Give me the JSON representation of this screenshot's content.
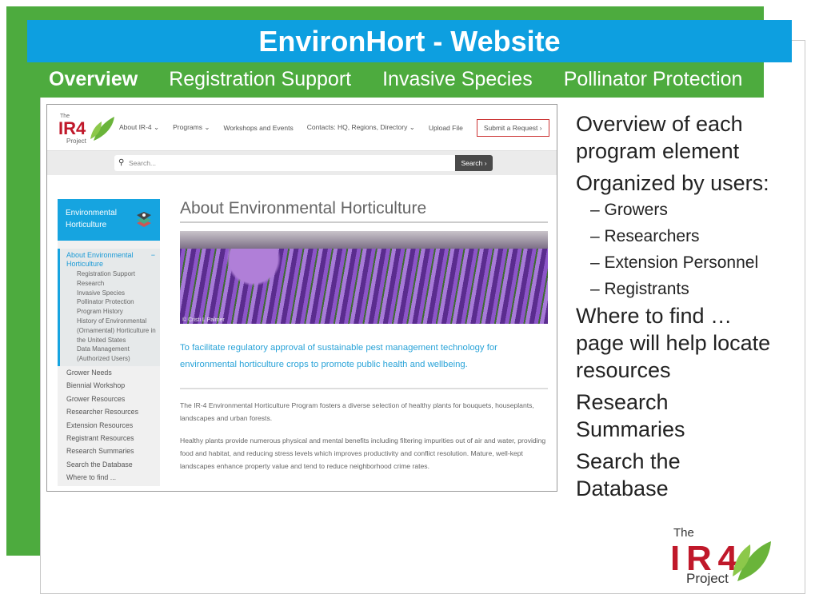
{
  "slide": {
    "title": "EnvironHort - Website",
    "tabs": [
      {
        "label": "Overview",
        "active": true
      },
      {
        "label": "Registration Support"
      },
      {
        "label": "Invasive Species"
      },
      {
        "label": "Pollinator Protection"
      }
    ],
    "bullets": {
      "b1": "Overview of each program element",
      "b2": "Organized by users:",
      "subs": [
        "– Growers",
        "– Researchers",
        "– Extension Personnel",
        "– Registrants"
      ],
      "b3": "Where to find … page will help locate resources",
      "b4": "Research Summaries",
      "b5": "Search the Database"
    },
    "logo": {
      "the": "The",
      "name": "IR-4",
      "project": "Project"
    }
  },
  "site": {
    "logo": {
      "the": "The",
      "name": "IR-4",
      "project": "Project"
    },
    "nav": [
      "About IR-4 ⌄",
      "Programs ⌄",
      "Workshops and Events",
      "Contacts: HQ, Regions, Directory ⌄",
      "Upload File"
    ],
    "submit": "Submit a Request  ›",
    "search_placeholder": "Search...",
    "search_button": "Search ›",
    "sidebar": {
      "title1": "Environmental",
      "title2": "Horticulture",
      "lead": "About Environmental Horticulture",
      "subitems": [
        "Registration Support Research",
        "Invasive Species",
        "Pollinator Protection",
        "Program History",
        "History of Environmental (Ornamental) Horticulture in the United States",
        "Data Management (Authorized Users)"
      ],
      "links": [
        "Grower Needs",
        "Biennial Workshop",
        "Grower Resources",
        "Researcher Resources",
        "Extension Resources",
        "Registrant Resources",
        "Research Summaries",
        "Search the Database",
        "Where to find ..."
      ]
    },
    "heading": "About Environmental Horticulture",
    "photo_credit": "© Cristi L Palmer",
    "mission": "To facilitate regulatory approval of sustainable pest management technology for environmental horticulture crops to promote public health and wellbeing.",
    "para1": "The IR-4 Environmental Horticulture Program fosters a diverse selection of healthy plants for bouquets, houseplants, landscapes and urban forests.",
    "para2": "Healthy plants provide numerous physical and mental benefits including filtering impurities out of air and water, providing food and habitat, and reducing stress levels which improves productivity and conflict resolution. Mature, well-kept landscapes enhance property value and tend to reduce neighborhood crime rates."
  },
  "colors": {
    "green": "#4dab3e",
    "blue": "#0d9fe0",
    "logo_red": "#c0182a",
    "leaf": "#6ab43a"
  }
}
